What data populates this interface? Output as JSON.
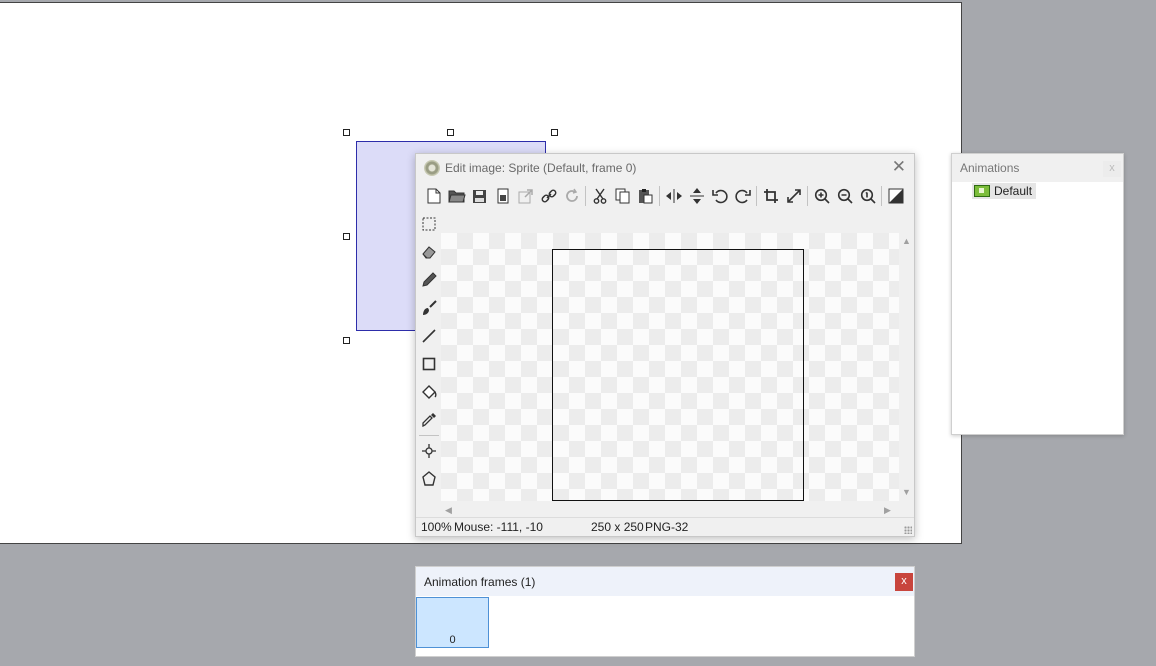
{
  "edit_window": {
    "title": "Edit image: Sprite (Default, frame 0)",
    "close_glyph": "✕",
    "toolbar": {
      "icons": [
        "new-image-icon",
        "open-folder-icon",
        "save-icon",
        "save-as-icon",
        "export-icon",
        "link-icon",
        "reload-icon",
        "cut-icon",
        "copy-icon",
        "paste-icon",
        "flip-horizontal-icon",
        "flip-vertical-icon",
        "rotate-left-icon",
        "rotate-right-icon",
        "crop-icon",
        "resize-icon",
        "zoom-in-icon",
        "zoom-out-icon",
        "zoom-reset-icon",
        "effects-icon"
      ]
    },
    "tools": [
      "rectangle-select-icon",
      "eraser-icon",
      "pencil-icon",
      "brush-icon",
      "line-icon",
      "rectangle-icon",
      "fill-bucket-icon",
      "color-picker-icon",
      "origin-icon",
      "collision-polygon-icon"
    ],
    "status": {
      "zoom": "100%",
      "mouse": "Mouse: -111, -10",
      "size": "250 x 250",
      "format": "PNG-32"
    }
  },
  "animations_panel": {
    "title": "Animations",
    "close_glyph": "x",
    "items": [
      {
        "label": "Default",
        "icon": "film-strip-icon"
      }
    ]
  },
  "frames_panel": {
    "title": "Animation frames (1)",
    "close_glyph": "x",
    "frames": [
      {
        "index": "0"
      }
    ]
  },
  "colors": {
    "workspace_bg": "#a6a8ad",
    "sprite_fill": "#dcdcf8",
    "sprite_border": "#2d2daa",
    "selected_frame": "#cce6ff",
    "close_red": "#c8453d"
  }
}
